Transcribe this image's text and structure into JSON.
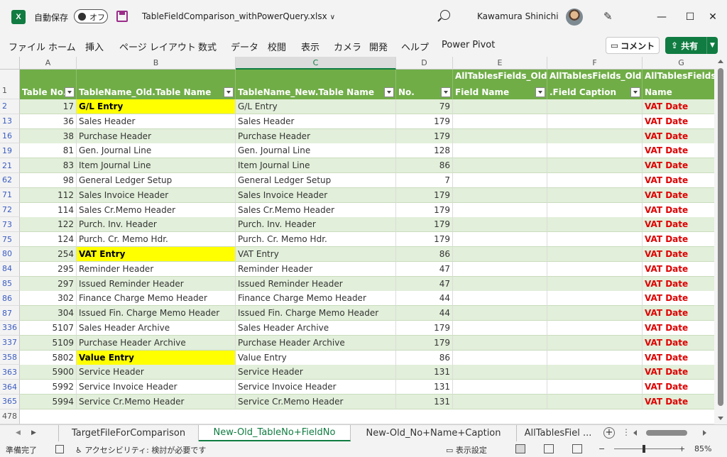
{
  "titlebar": {
    "app_logo": "X",
    "autosave_label": "自動保存",
    "autosave_state": "オフ",
    "file_name": "TableFieldComparison_withPowerQuery.xlsx",
    "user_name": "Kawamura Shinichi",
    "chevron": "∨",
    "minimize": "—",
    "maximize": "☐",
    "close": "✕"
  },
  "ribbon": {
    "tabs": [
      "ファイル",
      "ホーム",
      "挿入",
      "ページ レイアウト",
      "数式",
      "データ",
      "校閲",
      "表示",
      "カメラ",
      "開発",
      "ヘルプ",
      "Power Pivot"
    ],
    "comment_label": "コメント",
    "share_label": "共有"
  },
  "grid": {
    "column_letters": [
      "A",
      "B",
      "C",
      "D",
      "E",
      "F",
      "G"
    ],
    "selected_column": "C",
    "header_row_number": "1",
    "headers": [
      {
        "line1": "",
        "line2": "Table No."
      },
      {
        "line1": "",
        "line2": "TableName_Old.Table Name"
      },
      {
        "line1": "",
        "line2": "TableName_New.Table Name"
      },
      {
        "line1": "",
        "line2": "No."
      },
      {
        "line1": "AllTablesFields_Old.",
        "line2": "Field Name"
      },
      {
        "line1": "AllTablesFields_Old",
        "line2": ".Field Caption"
      },
      {
        "line1": "AllTablesFields",
        "line2": "Name"
      }
    ],
    "rows": [
      {
        "rownum": "2",
        "a": "17",
        "b": "G/L Entry",
        "c": "G/L Entry",
        "d": "79",
        "g": "VAT Date",
        "highlight": true
      },
      {
        "rownum": "13",
        "a": "36",
        "b": "Sales Header",
        "c": "Sales Header",
        "d": "179",
        "g": "VAT Date",
        "highlight": false
      },
      {
        "rownum": "16",
        "a": "38",
        "b": "Purchase Header",
        "c": "Purchase Header",
        "d": "179",
        "g": "VAT Date",
        "highlight": false
      },
      {
        "rownum": "19",
        "a": "81",
        "b": "Gen. Journal Line",
        "c": "Gen. Journal Line",
        "d": "128",
        "g": "VAT Date",
        "highlight": false
      },
      {
        "rownum": "21",
        "a": "83",
        "b": "Item Journal Line",
        "c": "Item Journal Line",
        "d": "86",
        "g": "VAT Date",
        "highlight": false
      },
      {
        "rownum": "62",
        "a": "98",
        "b": "General Ledger Setup",
        "c": "General Ledger Setup",
        "d": "7",
        "g": "VAT Date",
        "highlight": false
      },
      {
        "rownum": "71",
        "a": "112",
        "b": "Sales Invoice Header",
        "c": "Sales Invoice Header",
        "d": "179",
        "g": "VAT Date",
        "highlight": false
      },
      {
        "rownum": "72",
        "a": "114",
        "b": "Sales Cr.Memo Header",
        "c": "Sales Cr.Memo Header",
        "d": "179",
        "g": "VAT Date",
        "highlight": false
      },
      {
        "rownum": "73",
        "a": "122",
        "b": "Purch. Inv. Header",
        "c": "Purch. Inv. Header",
        "d": "179",
        "g": "VAT Date",
        "highlight": false
      },
      {
        "rownum": "75",
        "a": "124",
        "b": "Purch. Cr. Memo Hdr.",
        "c": "Purch. Cr. Memo Hdr.",
        "d": "179",
        "g": "VAT Date",
        "highlight": false
      },
      {
        "rownum": "80",
        "a": "254",
        "b": "VAT Entry",
        "c": "VAT Entry",
        "d": "86",
        "g": "VAT Date",
        "highlight": true
      },
      {
        "rownum": "84",
        "a": "295",
        "b": "Reminder Header",
        "c": "Reminder Header",
        "d": "47",
        "g": "VAT Date",
        "highlight": false
      },
      {
        "rownum": "85",
        "a": "297",
        "b": "Issued Reminder Header",
        "c": "Issued Reminder Header",
        "d": "47",
        "g": "VAT Date",
        "highlight": false
      },
      {
        "rownum": "86",
        "a": "302",
        "b": "Finance Charge Memo Header",
        "c": "Finance Charge Memo Header",
        "d": "44",
        "g": "VAT Date",
        "highlight": false
      },
      {
        "rownum": "87",
        "a": "304",
        "b": "Issued Fin. Charge Memo Header",
        "c": "Issued Fin. Charge Memo Header",
        "d": "44",
        "g": "VAT Date",
        "highlight": false
      },
      {
        "rownum": "336",
        "a": "5107",
        "b": "Sales Header Archive",
        "c": "Sales Header Archive",
        "d": "179",
        "g": "VAT Date",
        "highlight": false
      },
      {
        "rownum": "337",
        "a": "5109",
        "b": "Purchase Header Archive",
        "c": "Purchase Header Archive",
        "d": "179",
        "g": "VAT Date",
        "highlight": false
      },
      {
        "rownum": "358",
        "a": "5802",
        "b": "Value Entry",
        "c": "Value Entry",
        "d": "86",
        "g": "VAT Date",
        "highlight": true
      },
      {
        "rownum": "363",
        "a": "5900",
        "b": "Service Header",
        "c": "Service Header",
        "d": "131",
        "g": "VAT Date",
        "highlight": false
      },
      {
        "rownum": "364",
        "a": "5992",
        "b": "Service Invoice Header",
        "c": "Service Invoice Header",
        "d": "131",
        "g": "VAT Date",
        "highlight": false
      },
      {
        "rownum": "365",
        "a": "5994",
        "b": "Service Cr.Memo Header",
        "c": "Service Cr.Memo Header",
        "d": "131",
        "g": "VAT Date",
        "highlight": false
      }
    ],
    "last_row_number": "478"
  },
  "sheets": {
    "tabs": [
      "TargetFileForComparison",
      "New-Old_TableNo+FieldNo",
      "New-Old_No+Name+Caption",
      "AllTablesFiel ..."
    ],
    "active_index": 1,
    "add_symbol": "+",
    "more_symbol": "⋮"
  },
  "status": {
    "ready": "準備完了",
    "accessibility": "アクセシビリティ: 検討が必要です",
    "display_settings": "表示設定",
    "zoom_minus": "−",
    "zoom_plus": "+",
    "zoom_level": "85%",
    "zoom_fraction": 0.46
  },
  "colors": {
    "excel_green": "#107c41",
    "header_green": "#70ad47",
    "band_green": "#e2efda",
    "highlight_yellow": "#ffff00",
    "vat_red": "#e00000"
  }
}
